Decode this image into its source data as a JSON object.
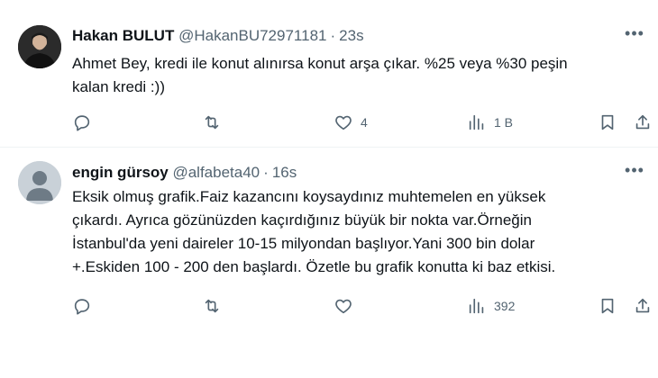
{
  "tweets": [
    {
      "name": "Hakan BULUT",
      "handle": "@HakanBU72971181",
      "separator": "·",
      "time": "23s",
      "text_lines": [
        "Ahmet Bey, kredi ile konut alınırsa konut arşa çıkar. %25 veya %30 peşin",
        "kalan kredi :))"
      ],
      "likes": "4",
      "views": "1 B",
      "more": "•••"
    },
    {
      "name": "engin gürsoy",
      "handle": "@alfabeta40",
      "separator": "·",
      "time": "16s",
      "text_lines": [
        "Eksik olmuş grafik.Faiz kazancını koysaydınız muhtemelen en yüksek",
        "çıkardı. Ayrıca gözünüzden kaçırdığınız büyük bir nokta var.Örneğin",
        "İstanbul'da yeni daireler 10-15 milyondan başlıyor.Yani 300 bin dolar",
        "+.Eskiden 100 - 200 den başlardı. Özetle bu grafik konutta ki baz etkisi."
      ],
      "likes": "",
      "views": "392",
      "more": "•••"
    }
  ],
  "icons": {
    "reply": "reply-icon",
    "retweet": "retweet-icon",
    "like": "heart-icon",
    "views": "views-icon",
    "bookmark": "bookmark-icon",
    "share": "share-icon"
  },
  "colors": {
    "text_primary": "#0f1419",
    "text_secondary": "#536471",
    "divider": "#eff3f4",
    "default_avatar": "#c9d1d8"
  }
}
